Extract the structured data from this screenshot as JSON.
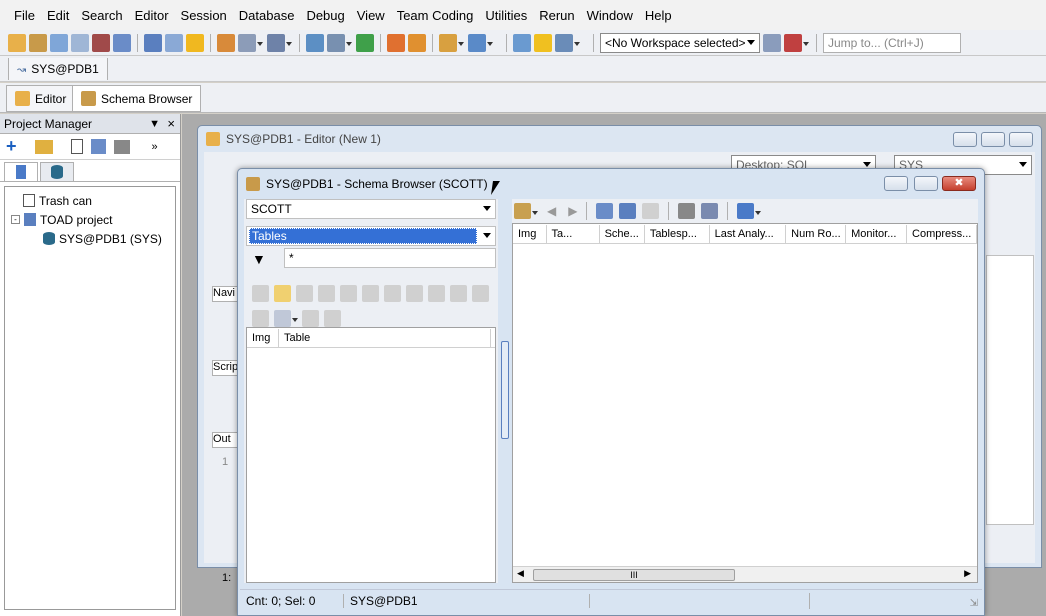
{
  "menu": [
    "File",
    "Edit",
    "Search",
    "Editor",
    "Session",
    "Database",
    "Debug",
    "View",
    "Team Coding",
    "Utilities",
    "Rerun",
    "Window",
    "Help"
  ],
  "toolbar": {
    "workspace": "<No Workspace selected>",
    "jump_placeholder": "Jump to... (Ctrl+J)"
  },
  "conn_tab": "SYS@PDB1",
  "main_tabs": {
    "editor": "Editor",
    "schema_browser": "Schema Browser"
  },
  "project_manager": {
    "title": "Project Manager",
    "items": [
      "Trash can",
      "TOAD project",
      "SYS@PDB1 (SYS)"
    ]
  },
  "editor_window": {
    "title": "SYS@PDB1 - Editor (New 1)",
    "desktop": "Desktop: SQL",
    "schema": "SYS",
    "left_labels": [
      "Navi",
      "Scrip",
      "Out"
    ],
    "line_num": "1",
    "status_pos": "1:"
  },
  "schema_browser": {
    "title": "SYS@PDB1 - Schema Browser (SCOTT)",
    "schema": "SCOTT",
    "object_type": "Tables",
    "filter": "*",
    "list_columns": [
      "Img",
      "Table"
    ],
    "detail_columns": [
      "Img",
      "Ta...",
      "Sche...",
      "Tablesp...",
      "Last Analy...",
      "Num Ro...",
      "Monitor...",
      "Compress..."
    ],
    "status_count": "Cnt: 0; Sel: 0",
    "status_conn": "SYS@PDB1",
    "scroll_mark": "III"
  }
}
